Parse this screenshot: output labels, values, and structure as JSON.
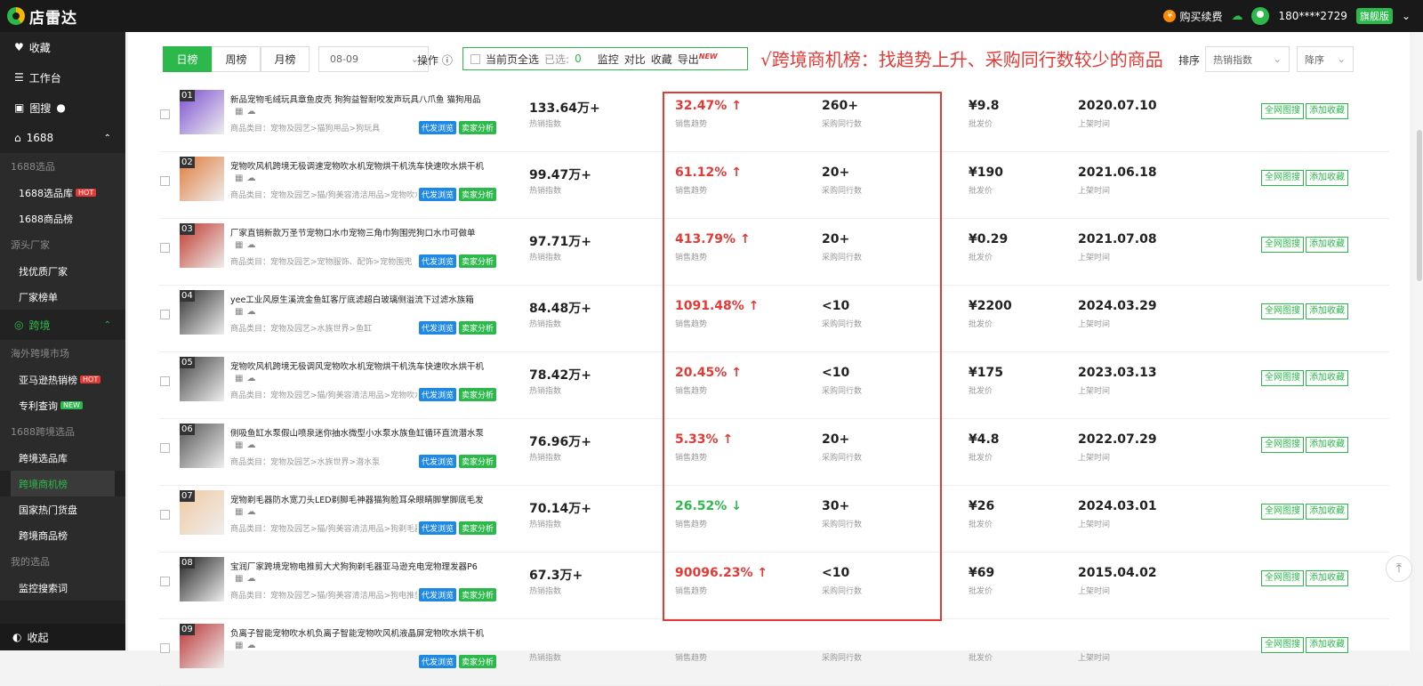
{
  "app": {
    "name": "店雷达"
  },
  "topbar": {
    "buy_label": "购买续费",
    "user": "180****2729",
    "vip": "旗舰版"
  },
  "sidebar": {
    "fav": "收藏",
    "workbench": "工作台",
    "image_search": "图搜",
    "section_1688": "1688",
    "group_1688": "1688选品",
    "lib_1688": "1688选品库",
    "rank_1688": "1688商品榜",
    "group_factory": "源头厂家",
    "find_factory": "找优质厂家",
    "factory_rank": "厂家榜单",
    "section_cross": "跨境",
    "group_overseas": "海外跨境市场",
    "amazon": "亚马逊热销榜",
    "patent": "专利查询",
    "group_cross": "1688跨境选品",
    "cross_lib": "跨境选品库",
    "cross_biz_rank": "跨境商机榜",
    "national_hot": "国家热门货盘",
    "cross_rank": "跨境商品榜",
    "group_mine": "我的选品",
    "monitor_search": "监控搜索词",
    "collapse": "收起",
    "hot_badge": "HOT",
    "new_badge": "NEW"
  },
  "toolbar": {
    "tabs": [
      "日榜",
      "周榜",
      "月榜"
    ],
    "date": "08-09",
    "op_label": "操作",
    "select_page": "当前页全选",
    "selected_label": "已选:",
    "selected_count": "0",
    "monitor": "监控",
    "compare": "对比",
    "collect": "收藏",
    "export": "导出",
    "export_new": "NEW",
    "headline": "√跨境商机榜：找趋势上升、采购同行数较少的商品",
    "sort_label": "排序",
    "sort_value": "热销指数",
    "order_value": "降序"
  },
  "labels": {
    "hot": "热销指数",
    "trend": "销售趋势",
    "buyers": "采购同行数",
    "price": "批发价",
    "date": "上架时间",
    "btn_dist": "代发浏览",
    "btn_seller": "卖家分析",
    "act_search": "全网图搜",
    "act_fav": "添加收藏"
  },
  "colors": {
    "accent": "#2db84c",
    "up": "#e53935",
    "down": "#2db84c"
  },
  "rows": [
    {
      "rank": "01",
      "title": "新品宠物毛绒玩具章鱼皮壳 狗狗益智耐咬发声玩具八爪鱼 猫狗用品",
      "cat": "商品类目：宠物及园艺>猫狗用品>狗玩具",
      "hot": "133.64万+",
      "trend": "32.47%",
      "dir": "up",
      "arrow": "↑",
      "buyers": "260+",
      "price": "¥9.8",
      "date": "2020.07.10"
    },
    {
      "rank": "02",
      "title": "宠物吹风机跨境无极调速宠物吹水机宠物烘干机洗车快速吹水烘干机",
      "cat": "商品类目：宠物及园艺>猫/狗美容清洁用品>宠物吹水机",
      "hot": "99.47万+",
      "trend": "61.12%",
      "dir": "up",
      "arrow": "↑",
      "buyers": "20+",
      "price": "¥190",
      "date": "2021.06.18"
    },
    {
      "rank": "03",
      "title": "厂家直销新款万圣节宠物口水巾宠物三角巾狗围兜狗口水巾可做单",
      "cat": "商品类目：宠物及园艺>宠物服饰、配饰>宠物围兜",
      "hot": "97.71万+",
      "trend": "413.79%",
      "dir": "up",
      "arrow": "↑",
      "buyers": "20+",
      "price": "¥0.29",
      "date": "2021.07.08"
    },
    {
      "rank": "04",
      "title": "yee工业风原生溪流金鱼缸客厅底滤超白玻璃侧溢流下过滤水族箱",
      "cat": "商品类目：宠物及园艺>水族世界>鱼缸",
      "hot": "84.48万+",
      "trend": "1091.48%",
      "dir": "up",
      "arrow": "↑",
      "buyers": "<10",
      "price": "¥2200",
      "date": "2024.03.29"
    },
    {
      "rank": "05",
      "title": "宠物吹风机跨境无极调风宠物吹水机宠物烘干机洗车快速吹水烘干机",
      "cat": "商品类目：宠物及园艺>猫/狗美容清洁用品>宠物吹水机",
      "hot": "78.42万+",
      "trend": "20.45%",
      "dir": "up",
      "arrow": "↑",
      "buyers": "<10",
      "price": "¥175",
      "date": "2023.03.13"
    },
    {
      "rank": "06",
      "title": "侧吸鱼缸水泵假山喷泉迷你抽水微型小水泵水族鱼缸循环直流潜水泵",
      "cat": "商品类目：宠物及园艺>水族世界>潜水泵",
      "hot": "76.96万+",
      "trend": "5.33%",
      "dir": "up",
      "arrow": "↑",
      "buyers": "20+",
      "price": "¥4.8",
      "date": "2022.07.29"
    },
    {
      "rank": "07",
      "title": "宠物剃毛器防水宽刀头LED剃脚毛神器猫狗脸耳朵眼睛脚掌脚底毛发",
      "cat": "商品类目：宠物及园艺>猫/狗美容清洁用品>狗剃毛器",
      "hot": "70.14万+",
      "trend": "26.52%",
      "dir": "down",
      "arrow": "↓",
      "buyers": "30+",
      "price": "¥26",
      "date": "2024.03.01"
    },
    {
      "rank": "08",
      "title": "宝润厂家跨境宠物电推剪大犬狗狗剃毛器亚马逊充电宠物理发器P6",
      "cat": "商品类目：宠物及园艺>猫/狗美容清洁用品>狗电推剪",
      "hot": "67.3万+",
      "trend": "90096.23%",
      "dir": "up",
      "arrow": "↑",
      "buyers": "<10",
      "price": "¥69",
      "date": "2015.04.02"
    },
    {
      "rank": "09",
      "title": "负离子智能宠物吹水机负离子智能宠物吹风机液晶屏宠物吹水烘干机",
      "cat": "",
      "hot": "",
      "trend": "",
      "dir": "up",
      "arrow": "",
      "buyers": "",
      "price": "",
      "date": ""
    }
  ]
}
